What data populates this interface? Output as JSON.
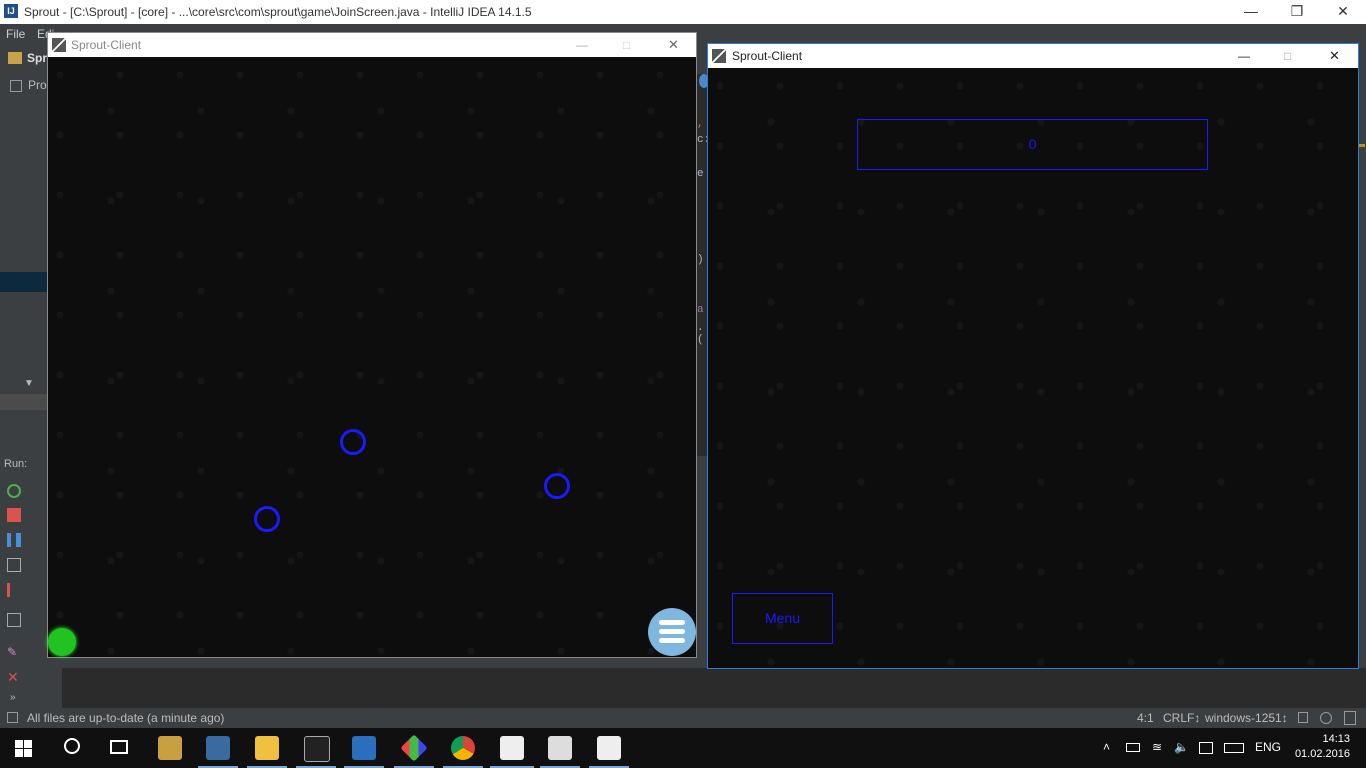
{
  "ide": {
    "title": "Sprout - [C:\\Sprout] - [core] - ...\\core\\src\\com\\sprout\\game\\JoinScreen.java - IntelliJ IDEA 14.1.5",
    "logo_text": "IJ",
    "menu_first": "File",
    "menu_edit": "Edi",
    "project_label": "Spr",
    "project_tab": "Pro",
    "run_label": "Run:",
    "editor_fragments": [
      ",",
      "c:",
      "e",
      ")",
      "a",
      ".("
    ],
    "status": {
      "message": "All files are up-to-date (a minute ago)",
      "position": "4:1",
      "line_ending": "CRLF↕",
      "encoding": "windows-1251↕"
    },
    "window_controls": {
      "minimize": "—",
      "restore": "❐",
      "close": "✕"
    }
  },
  "client_left": {
    "title": "Sprout-Client",
    "controls": {
      "minimize": "—",
      "maximize": "□",
      "close": "✕"
    }
  },
  "client_right": {
    "title": "Sprout-Client",
    "controls": {
      "minimize": "—",
      "maximize": "□",
      "close": "✕"
    },
    "score": "0",
    "menu_button": "Menu"
  },
  "taskbar": {
    "language": "ENG",
    "time": "14:13",
    "date": "01.02.2016"
  },
  "colors": {
    "node_blue": "#1a1aff",
    "player_green": "#21c321",
    "fab_blue": "#7fb7e0",
    "ide_dark": "#3c3f41"
  }
}
